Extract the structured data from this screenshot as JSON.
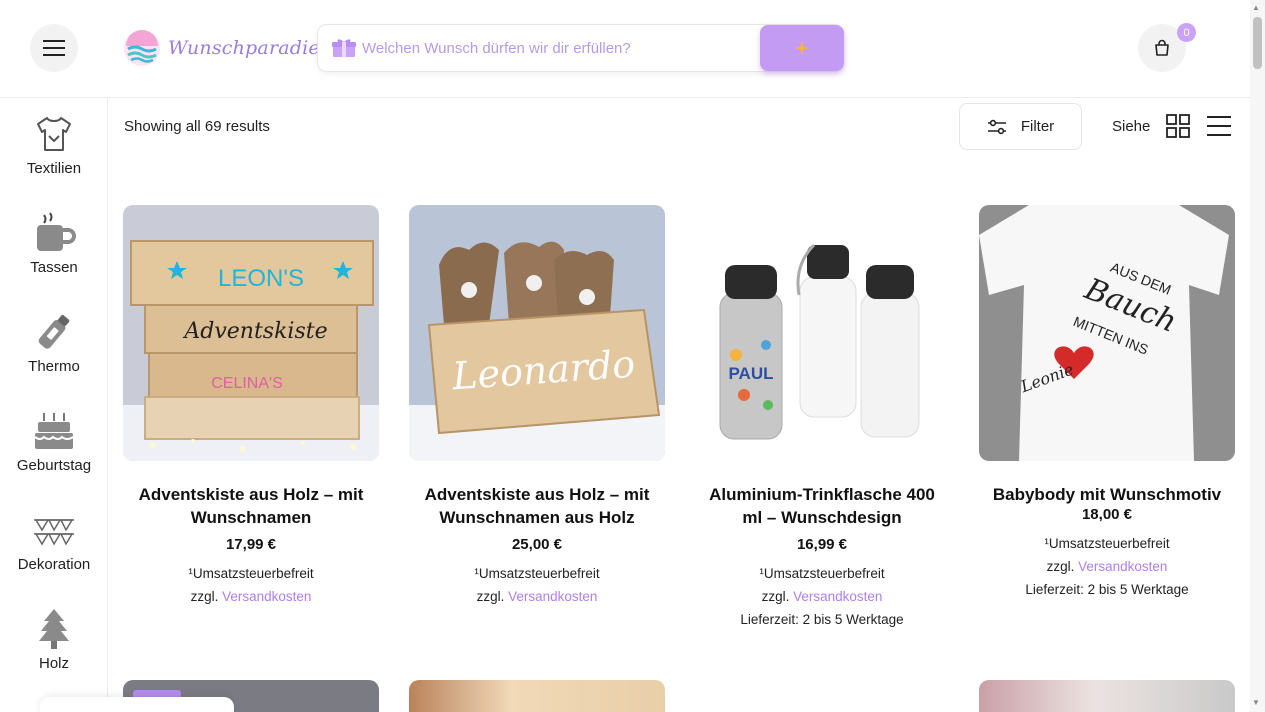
{
  "header": {
    "brand": "Wunschparadies",
    "search_placeholder": "Welchen Wunsch dürfen wir dir erfüllen?",
    "cart_count": "0",
    "icons": {
      "menu": "hamburger-icon",
      "search": "sparkle-icon",
      "cart": "shopping-bag-icon"
    },
    "accent_color": "#c39bf3"
  },
  "sidebar": {
    "items": [
      {
        "label": "Textilien",
        "icon": "tshirt-icon"
      },
      {
        "label": "Tassen",
        "icon": "mug-icon"
      },
      {
        "label": "Thermo",
        "icon": "thermo-bottle-icon"
      },
      {
        "label": "Geburtstag",
        "icon": "cake-icon"
      },
      {
        "label": "Dekoration",
        "icon": "bunting-icon"
      },
      {
        "label": "Holz",
        "icon": "tree-icon"
      }
    ]
  },
  "toolbar": {
    "results_text": "Showing all 69 results",
    "filter_label": "Filter",
    "view_label": "Siehe"
  },
  "products": [
    {
      "title": "Adventskiste aus Holz – mit Wunschnamen",
      "price": "17,99 €",
      "tax_note": "¹Umsatzsteuerbefreit",
      "shipping_prefix": "zzgl.",
      "shipping_link": "Versandkosten",
      "delivery": ""
    },
    {
      "title": "Adventskiste aus Holz – mit Wunschnamen aus Holz",
      "price": "25,00 €",
      "tax_note": "¹Umsatzsteuerbefreit",
      "shipping_prefix": "zzgl.",
      "shipping_link": "Versandkosten",
      "delivery": ""
    },
    {
      "title": "Aluminium-Trinkflasche 400 ml – Wunschdesign",
      "price": "16,99 €",
      "tax_note": "¹Umsatzsteuerbefreit",
      "shipping_prefix": "zzgl.",
      "shipping_link": "Versandkosten",
      "delivery": "Lieferzeit: 2 bis 5 Werktage"
    },
    {
      "title": "Babybody mit Wunschmotiv",
      "price": "18,00 €",
      "tax_note": "¹Umsatzsteuerbefreit",
      "shipping_prefix": "zzgl.",
      "shipping_link": "Versandkosten",
      "delivery": "Lieferzeit: 2 bis 5 Werktage"
    }
  ],
  "product_image_text": {
    "p1_line1": "LEON'S",
    "p1_line2": "Adventskiste",
    "p1_line3": "CELINA'S",
    "p2_name": "Leonardo",
    "p3_name": "PAUL",
    "p4_line1": "AUS DEM",
    "p4_line2": "Bauch",
    "p4_line3": "MITTEN INS",
    "p4_line4": "Leonie"
  }
}
